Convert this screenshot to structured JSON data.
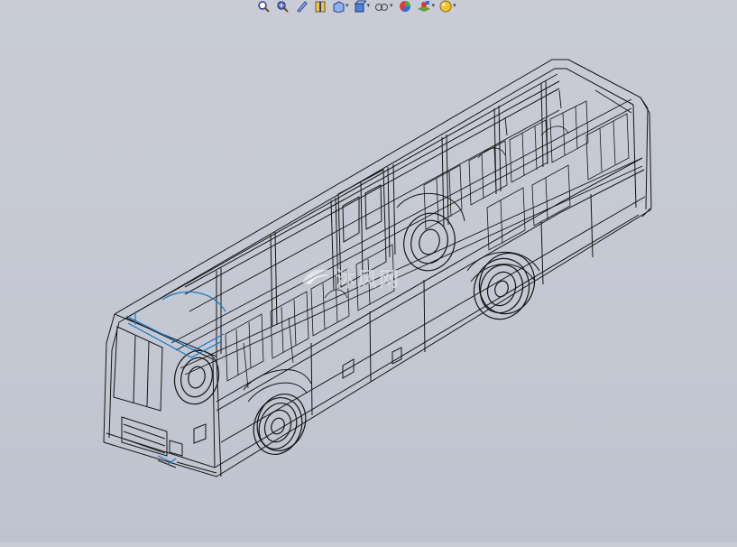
{
  "toolbar": {
    "buttons": [
      {
        "name": "zoom-to-fit-icon",
        "glyph": "⌕",
        "dropdown": false
      },
      {
        "name": "zoom-to-area-icon",
        "glyph": "⌕",
        "dropdown": false
      },
      {
        "name": "previous-view-icon",
        "glyph": "✎",
        "dropdown": false
      },
      {
        "name": "section-view-icon",
        "glyph": "▥",
        "dropdown": false
      },
      {
        "name": "view-orientation-icon",
        "glyph": "❒",
        "dropdown": true
      },
      {
        "name": "display-style-icon",
        "glyph": "❑",
        "dropdown": true
      },
      {
        "name": "hide-show-items-icon",
        "glyph": "∞",
        "dropdown": true
      },
      {
        "name": "edit-appearance-icon",
        "glyph": "◕",
        "dropdown": false
      },
      {
        "name": "apply-scene-icon",
        "glyph": "⬙",
        "dropdown": true
      },
      {
        "name": "view-settings-icon",
        "glyph": "●",
        "dropdown": true
      }
    ]
  },
  "watermark": {
    "text": "沐风网"
  },
  "colors": {
    "wireframe": "#111111",
    "selection": "#1a78c2",
    "background": "#c6cad5"
  }
}
